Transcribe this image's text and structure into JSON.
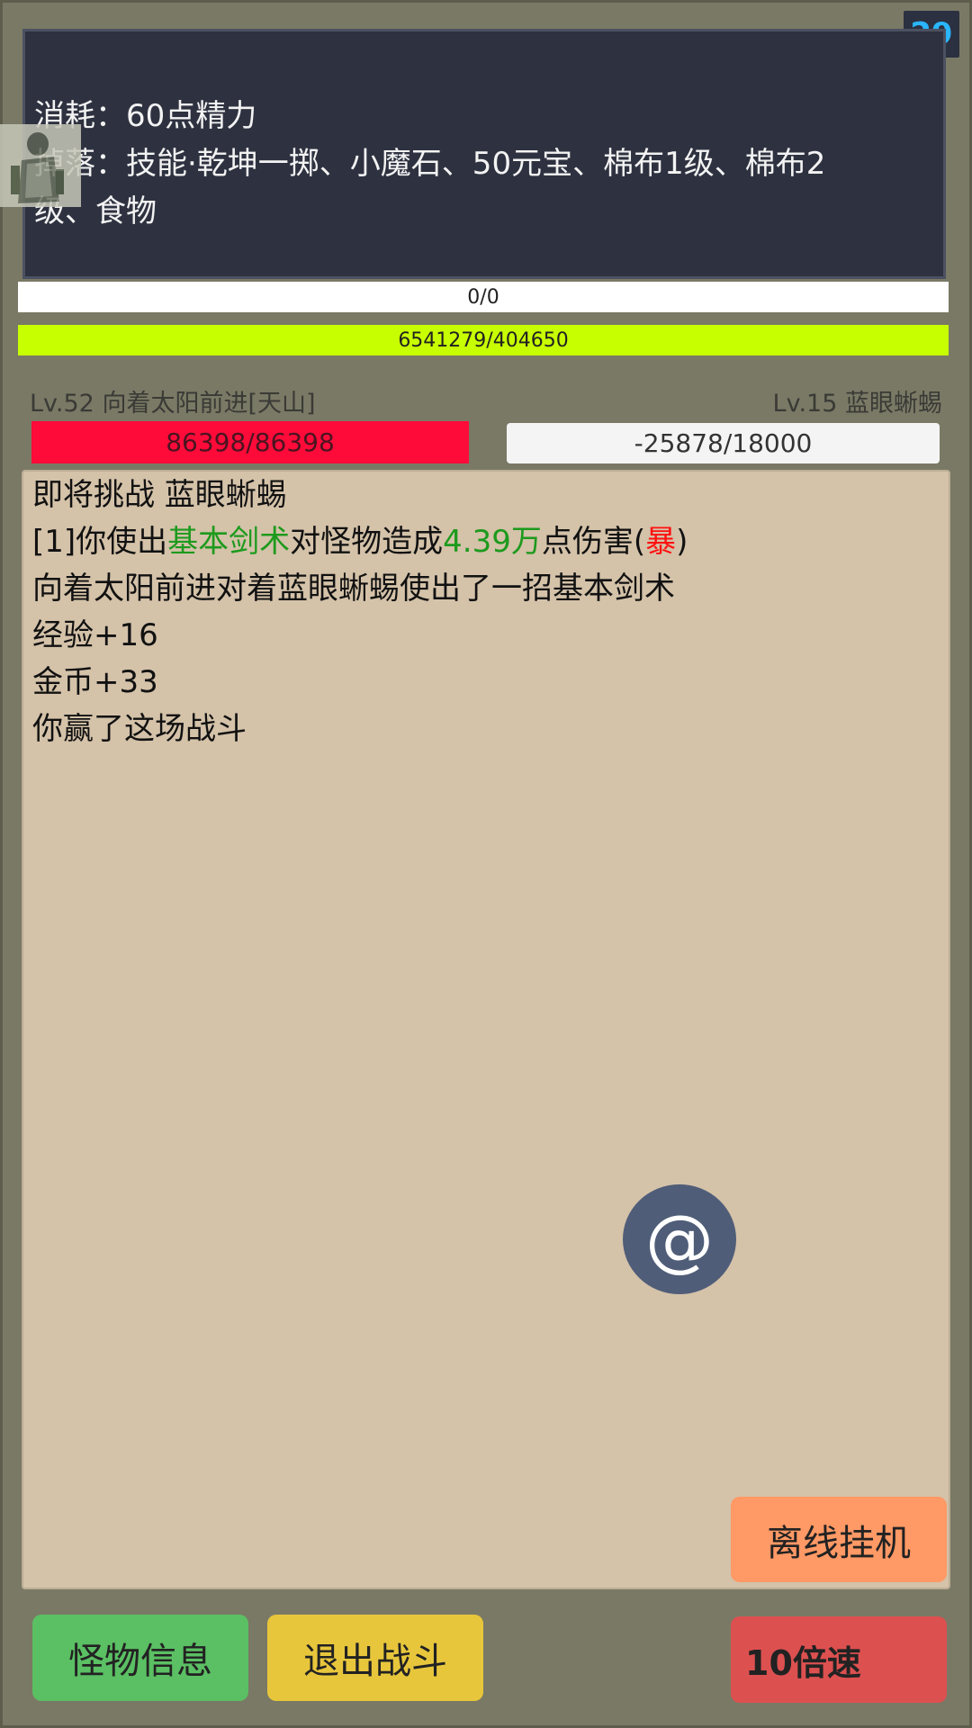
{
  "top_counter": "29",
  "info_panel": {
    "cost_line": "消耗：60点精力",
    "drop_line1": "掉落：技能·乾坤一掷、小魔石、50元宝、棉布1级、棉布2",
    "drop_line2": "级、食物"
  },
  "bars": {
    "bar_a": {
      "label": "0/0",
      "fraction": 0
    },
    "bar_b": {
      "label": "6541279/404650",
      "fraction": 1.0
    }
  },
  "player": {
    "level_label": "Lv.52 向着太阳前进[天山]",
    "hp_label": "86398/86398",
    "hp_fraction": 1.0
  },
  "enemy": {
    "level_label": "Lv.15 蓝眼蜥蜴",
    "hp_label": "-25878/18000",
    "hp_fraction": 0
  },
  "battle_log": {
    "line1": "即将挑战 蓝眼蜥蜴",
    "line2": {
      "p1": "[1]你使出",
      "skill": "基本剑术",
      "p2": "对怪物造成",
      "damage": "4.39万",
      "p3": "点伤害(",
      "crit": "暴",
      "p4": ")"
    },
    "line3": "向着太阳前进对着蓝眼蜥蜴使出了一招基本剑术",
    "line4": "经验+16",
    "line5": "金币+33",
    "line6": "你赢了这场战斗"
  },
  "float_button": "@",
  "buttons": {
    "offline": "离线挂机",
    "monster_info": "怪物信息",
    "exit_battle": "退出战斗",
    "speed": "10倍速"
  },
  "colors": {
    "background": "#7a7965",
    "player_hp": "#ff0b3a",
    "exp_bar": "#c8ff00",
    "log_bg": "#d4c2a9",
    "highlight_green": "#1d9a1d",
    "highlight_red": "#ff1010"
  }
}
